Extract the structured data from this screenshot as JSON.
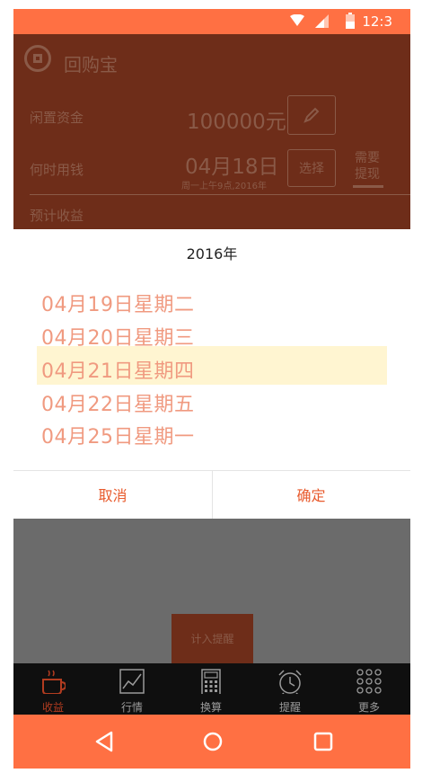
{
  "status_bar": {
    "time": "12:3"
  },
  "header": {
    "app_title": "回购宝",
    "idle_funds_label": "闲置资金",
    "idle_funds_value": "100000元",
    "when_label": "何时用钱",
    "when_date": "04月18日",
    "when_subtitle": "周一上午9点,2016年",
    "select_button": "选择",
    "need_withdraw": "需要\n提现",
    "expected_label": "预计收益"
  },
  "dialog": {
    "year": "2016年",
    "options": [
      "04月19日星期二",
      "04月20日星期三",
      "04月21日星期四",
      "04月22日星期五",
      "04月25日星期一"
    ],
    "selected_index": 2,
    "cancel": "取消",
    "confirm": "确定"
  },
  "remind_button": "计入提醒",
  "tabs": [
    {
      "label": "收益",
      "icon": "coffee-cup-icon",
      "active": true
    },
    {
      "label": "行情",
      "icon": "line-chart-icon",
      "active": false
    },
    {
      "label": "换算",
      "icon": "calculator-icon",
      "active": false
    },
    {
      "label": "提醒",
      "icon": "alarm-clock-icon",
      "active": false
    },
    {
      "label": "更多",
      "icon": "grid-dots-icon",
      "active": false
    }
  ],
  "colors": {
    "accent": "#ff7043",
    "header_dim": "#6e2d19",
    "option_text": "#f09a80",
    "selected_bg": "#fff5d1",
    "button_text": "#e85a2c"
  }
}
